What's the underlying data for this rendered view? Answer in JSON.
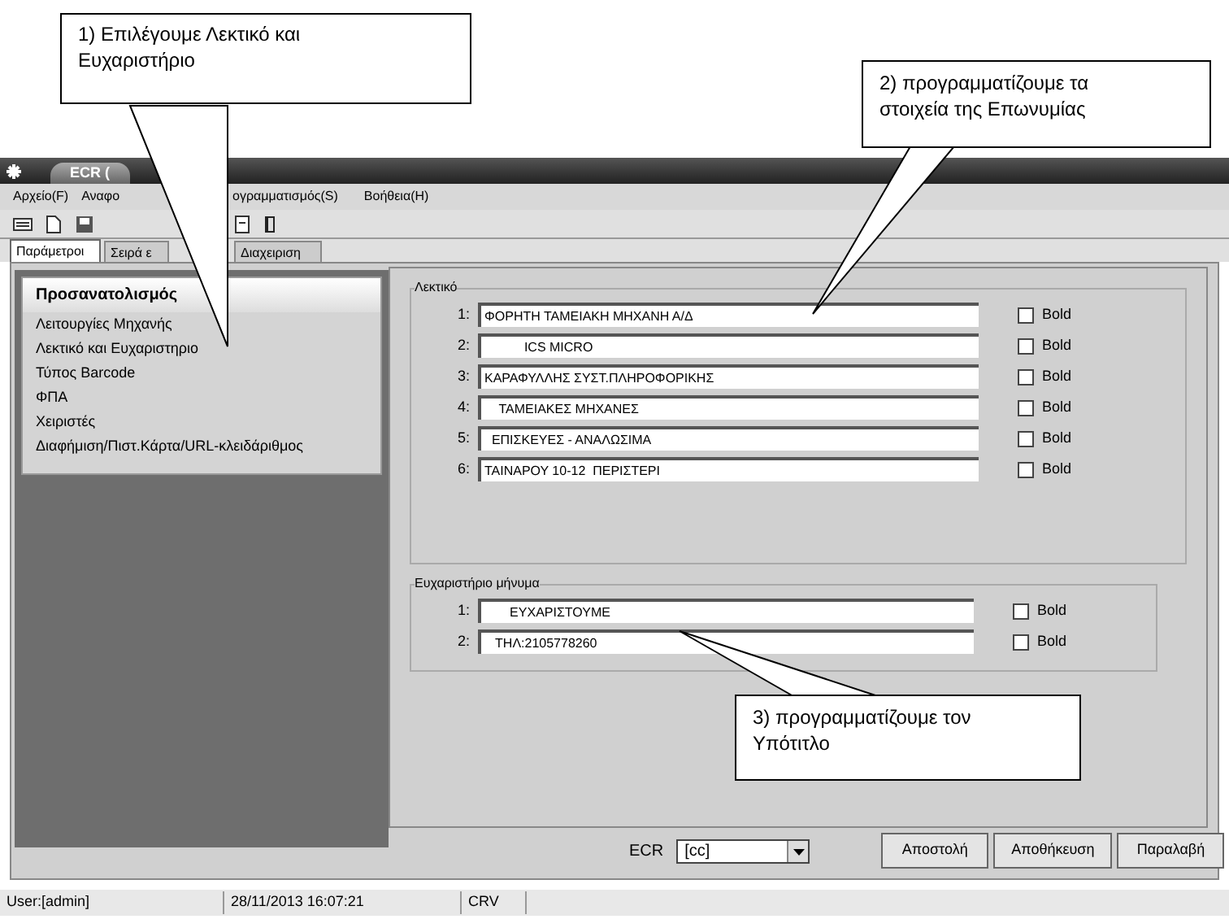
{
  "window": {
    "title": "ECR ("
  },
  "menu": [
    "Αρχείο(F)",
    "Αναφο",
    "ογραμματισμός(S)",
    "Βοήθεια(H)"
  ],
  "tabs": [
    {
      "label": "Παράμετροι",
      "selected": true
    },
    {
      "label": "Σειρά ε",
      "selected": false
    },
    {
      "label": "Διαχειριση",
      "selected": false
    }
  ],
  "sidebar": {
    "heading": "Προσανατολισμός",
    "items": [
      "Λειτουργίες Μηχανής",
      "Λεκτικό και Ευχαριστηριο",
      "Τύπος Barcode",
      "ΦΠΑ",
      "Χειριστές",
      "Διαφήμιση/Πιστ.Κάρτα/URL-κλειδάριθμος"
    ]
  },
  "header_group": {
    "title": "Λεκτικό",
    "rows": [
      {
        "number": "1:",
        "value": "ΦΟΡΗΤΗ ΤΑΜΕΙΑΚΗ ΜΗΧΑΝΗ Α/Δ",
        "bold_label": "Bold",
        "checked": false
      },
      {
        "number": "2:",
        "value": "           ICS MICRO",
        "bold_label": "Bold",
        "checked": false
      },
      {
        "number": "3:",
        "value": "ΚΑΡΑΦΥΛΛΗΣ ΣΥΣΤ.ΠΛΗΡΟΦΟΡΙΚΗΣ",
        "bold_label": "Bold",
        "checked": false
      },
      {
        "number": "4:",
        "value": "    ΤΑΜΕΙΑΚΕΣ ΜΗΧΑΝΕΣ",
        "bold_label": "Bold",
        "checked": false
      },
      {
        "number": "5:",
        "value": "  ΕΠΙΣΚΕΥΕΣ - ΑΝΑΛΩΣΙΜΑ",
        "bold_label": "Bold",
        "checked": false
      },
      {
        "number": "6:",
        "value": "ΤΑΙΝΑΡΟΥ 10-12  ΠΕΡΙΣΤΕΡΙ",
        "bold_label": "Bold",
        "checked": false
      }
    ]
  },
  "thanks_group": {
    "title": "Ευχαριστήριο μήνυμα",
    "rows": [
      {
        "number": "1:",
        "value": "       ΕΥΧΑΡΙΣΤΟΥΜΕ",
        "bold_label": "Bold",
        "checked": false
      },
      {
        "number": "2:",
        "value": "   ΤΗΛ:2105778260",
        "bold_label": "Bold",
        "checked": false
      }
    ]
  },
  "ecr": {
    "label": "ECR",
    "value": "[cc]"
  },
  "buttons": [
    "Αποστολή",
    "Αποθήκευση",
    "Παραλαβή"
  ],
  "status_bar": [
    "User:[admin]",
    "28/11/2013 16:07:21",
    "CRV"
  ],
  "callouts": [
    "1) Επιλέγουμε Λεκτικό και Ευχαριστήριο",
    "2) προγραμματίζουμε τα στοιχεία της Επωνυμίας",
    "3) προγραμματίζουμε τον Υπότιτλο"
  ]
}
